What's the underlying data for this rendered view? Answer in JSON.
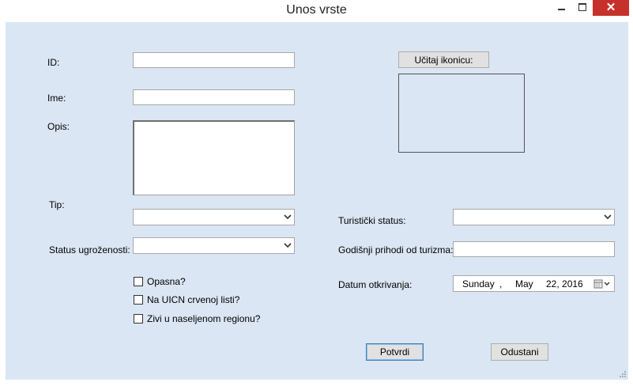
{
  "window": {
    "title": "Unos vrste",
    "close_glyph": "✕"
  },
  "form": {
    "id_label": "ID:",
    "id_value": "",
    "ime_label": "Ime:",
    "ime_value": "",
    "opis_label": "Opis:",
    "opis_value": "",
    "tip_label": "Tip:",
    "tip_value": "",
    "status_label": "Status ugroženosti:",
    "status_value": "",
    "opasna_label": "Opasna?",
    "uicn_label": "Na UICN crvenoj listi?",
    "zivi_label": "Zivi u naseljenom regionu?",
    "ucitaj_label": "Učitaj ikonicu:",
    "turisticki_label": "Turistički status:",
    "turisticki_value": "",
    "prihodi_label": "Godišnji prihodi od turizma:",
    "prihodi_value": "",
    "datum_label": "Datum otkrivanja:",
    "datum": {
      "weekday": "Sunday",
      "sep": ",",
      "month": "May",
      "day_year": "22, 2016"
    },
    "potvrdi_label": "Potvrdi",
    "odustani_label": "Odustani"
  },
  "icons": [
    "minimize-icon",
    "maximize-icon",
    "close-icon",
    "dropdown-arrow-icon",
    "calendar-icon",
    "resize-grip-icon"
  ],
  "colors": {
    "client_bg": "#dae6f3",
    "close_button": "#c7312b"
  }
}
